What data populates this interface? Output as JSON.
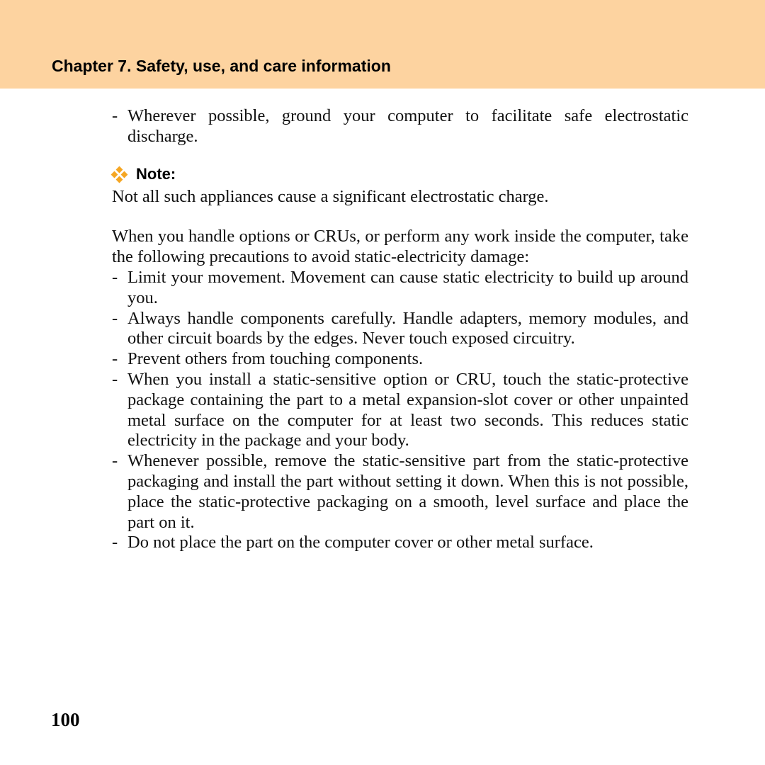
{
  "header": {
    "chapter_title": "Chapter 7. Safety, use, and care information",
    "band_color": "#fdd3a0"
  },
  "intro_bullet": {
    "dash": "-",
    "text": "Wherever possible, ground your computer to facilitate safe electrostatic discharge."
  },
  "note": {
    "icon": "orange-diamond-cluster-icon",
    "label": "Note:",
    "text": "Not all such appliances cause a significant electrostatic charge."
  },
  "precautions": {
    "intro": "When you handle options or CRUs, or perform any work inside the computer, take the following precautions to avoid static-electricity damage:",
    "items": [
      {
        "dash": "-",
        "text": "Limit your movement. Movement can cause static electricity to build up around you."
      },
      {
        "dash": "-",
        "text": "Always handle components carefully. Handle adapters, memory modules, and other circuit boards by the edges. Never touch exposed circuitry."
      },
      {
        "dash": "-",
        "text": "Prevent others from touching components."
      },
      {
        "dash": "-",
        "text": "When you install a static-sensitive option or CRU, touch the static-protective package containing the part to a metal expansion-slot cover or other unpainted metal surface on the computer for at least two seconds. This reduces static electricity in the package and your body."
      },
      {
        "dash": "-",
        "text": "Whenever possible, remove the static-sensitive part from the static-protective packaging and install the part without setting it down. When this is not possible, place the static-protective packaging on a smooth, level surface and place the part on it."
      },
      {
        "dash": "-",
        "text": "Do not place the part on the computer cover or other metal surface."
      }
    ]
  },
  "footer": {
    "page_number": "100"
  }
}
